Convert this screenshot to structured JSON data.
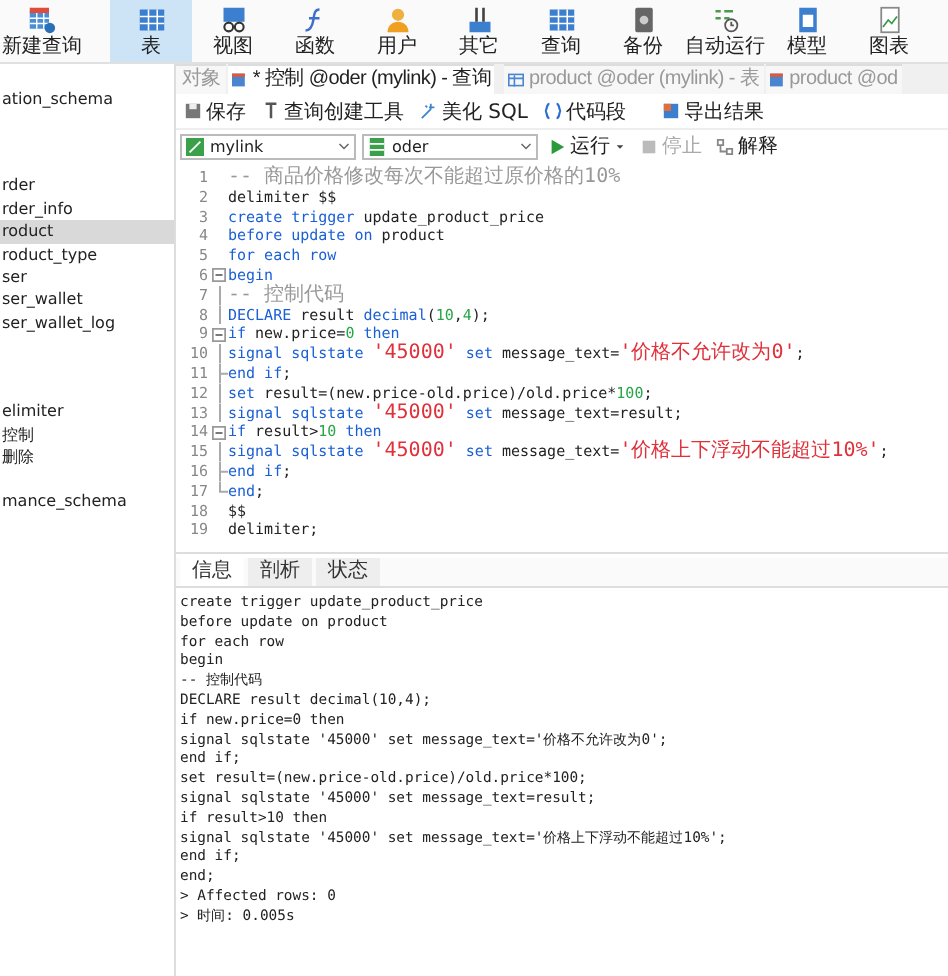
{
  "toolbar": [
    {
      "label": "新建查询",
      "selected": false
    },
    {
      "label": "表",
      "selected": true
    },
    {
      "label": "视图",
      "selected": false
    },
    {
      "label": "函数",
      "selected": false
    },
    {
      "label": "用户",
      "selected": false
    },
    {
      "label": "其它",
      "selected": false
    },
    {
      "label": "查询",
      "selected": false
    },
    {
      "label": "备份",
      "selected": false
    },
    {
      "label": "自动运行",
      "selected": false
    },
    {
      "label": "模型",
      "selected": false
    },
    {
      "label": "图表",
      "selected": false
    }
  ],
  "sidebar": {
    "groups": [
      [
        {
          "label": "ation_schema",
          "selected": false
        }
      ],
      [
        {
          "label": "rder",
          "selected": false
        },
        {
          "label": "rder_info",
          "selected": false
        },
        {
          "label": "roduct",
          "selected": true
        },
        {
          "label": "roduct_type",
          "selected": false
        },
        {
          "label": "ser",
          "selected": false
        },
        {
          "label": "ser_wallet",
          "selected": false
        },
        {
          "label": "ser_wallet_log",
          "selected": false
        }
      ],
      [
        {
          "label": "elimiter",
          "selected": false
        },
        {
          "label": "控制",
          "selected": false
        },
        {
          "label": "删除",
          "selected": false
        }
      ],
      [
        {
          "label": "mance_schema",
          "selected": false
        }
      ]
    ]
  },
  "tabs": [
    {
      "label": "对象",
      "selected": false,
      "kind": "plain"
    },
    {
      "label": "* 控制 @oder (mylink) - 查询",
      "selected": true,
      "kind": "query"
    },
    {
      "label": "product @oder (mylink) - 表",
      "selected": false,
      "kind": "table"
    },
    {
      "label": "product @od",
      "selected": false,
      "kind": "query"
    }
  ],
  "actions": [
    {
      "label": "保存",
      "kind": "save"
    },
    {
      "label": "查询创建工具",
      "kind": "builder"
    },
    {
      "label": "美化 SQL",
      "kind": "beautify"
    },
    {
      "label": "代码段",
      "kind": "snippet"
    },
    {
      "label": "导出结果",
      "kind": "export"
    }
  ],
  "connection": "mylink",
  "database": "oder",
  "run": [
    {
      "label": "运行",
      "kind": "run",
      "disabled": false
    },
    {
      "label": "停止",
      "kind": "stop",
      "disabled": true
    },
    {
      "label": "解释",
      "kind": "explain",
      "disabled": false
    }
  ],
  "editor": {
    "lines": [
      {
        "no": "1",
        "kind": "plain",
        "segments": [
          {
            "kind": "comment",
            "text": "-- 商品价格修改每次不能超过原价格的10%"
          }
        ]
      },
      {
        "no": "2",
        "kind": "plain",
        "segments": [
          {
            "kind": "plain",
            "text": "delimiter $$"
          }
        ]
      },
      {
        "no": "3",
        "kind": "plain",
        "segments": [
          {
            "kind": "keyword",
            "text": "create trigger"
          },
          {
            "kind": "plain",
            "text": " update_product_price"
          }
        ]
      },
      {
        "no": "4",
        "kind": "plain",
        "segments": [
          {
            "kind": "keyword",
            "text": "before update on"
          },
          {
            "kind": "plain",
            "text": " product"
          }
        ]
      },
      {
        "no": "5",
        "kind": "plain",
        "segments": [
          {
            "kind": "keyword",
            "text": "for each row"
          }
        ]
      },
      {
        "no": "6",
        "kind": "foldstart",
        "segments": [
          {
            "kind": "keyword",
            "text": "begin"
          }
        ]
      },
      {
        "no": "7",
        "kind": "foldbody",
        "segments": [
          {
            "kind": "comment",
            "text": "-- 控制代码"
          }
        ]
      },
      {
        "no": "8",
        "kind": "foldbody",
        "segments": [
          {
            "kind": "keyword",
            "text": "DECLARE"
          },
          {
            "kind": "plain",
            "text": " result "
          },
          {
            "kind": "keyword",
            "text": "decimal"
          },
          {
            "kind": "plain",
            "text": "("
          },
          {
            "kind": "number",
            "text": "10"
          },
          {
            "kind": "plain",
            "text": ","
          },
          {
            "kind": "number",
            "text": "4"
          },
          {
            "kind": "plain",
            "text": ");"
          }
        ]
      },
      {
        "no": "9",
        "kind": "foldstart",
        "segments": [
          {
            "kind": "keyword",
            "text": "if"
          },
          {
            "kind": "plain",
            "text": " new.price="
          },
          {
            "kind": "number",
            "text": "0"
          },
          {
            "kind": "keyword",
            "text": " then"
          }
        ]
      },
      {
        "no": "10",
        "kind": "foldbody",
        "segments": [
          {
            "kind": "keyword",
            "text": "signal sqlstate "
          },
          {
            "kind": "string",
            "text": "'45000'"
          },
          {
            "kind": "keyword",
            "text": " set"
          },
          {
            "kind": "plain",
            "text": " message_text="
          },
          {
            "kind": "string",
            "text": "'价格不允许改为0'"
          },
          {
            "kind": "plain",
            "text": ";"
          }
        ]
      },
      {
        "no": "11",
        "kind": "foldclose",
        "segments": [
          {
            "kind": "keyword",
            "text": "end if"
          },
          {
            "kind": "plain",
            "text": ";"
          }
        ]
      },
      {
        "no": "12",
        "kind": "foldbody",
        "segments": [
          {
            "kind": "keyword",
            "text": "set"
          },
          {
            "kind": "plain",
            "text": " result=(new.price-old.price)/old.price*"
          },
          {
            "kind": "number",
            "text": "100"
          },
          {
            "kind": "plain",
            "text": ";"
          }
        ]
      },
      {
        "no": "13",
        "kind": "foldbody",
        "segments": [
          {
            "kind": "keyword",
            "text": "signal sqlstate "
          },
          {
            "kind": "string",
            "text": "'45000'"
          },
          {
            "kind": "keyword",
            "text": " set"
          },
          {
            "kind": "plain",
            "text": " message_text=result;"
          }
        ]
      },
      {
        "no": "14",
        "kind": "foldstart",
        "segments": [
          {
            "kind": "keyword",
            "text": "if"
          },
          {
            "kind": "plain",
            "text": " result>"
          },
          {
            "kind": "number",
            "text": "10"
          },
          {
            "kind": "keyword",
            "text": " then"
          }
        ]
      },
      {
        "no": "15",
        "kind": "foldbody",
        "segments": [
          {
            "kind": "keyword",
            "text": "signal sqlstate "
          },
          {
            "kind": "string",
            "text": "'45000'"
          },
          {
            "kind": "keyword",
            "text": " set"
          },
          {
            "kind": "plain",
            "text": " message_text="
          },
          {
            "kind": "string",
            "text": "'价格上下浮动不能超过10%'"
          },
          {
            "kind": "plain",
            "text": ";"
          }
        ]
      },
      {
        "no": "16",
        "kind": "foldclose",
        "segments": [
          {
            "kind": "keyword",
            "text": "end if"
          },
          {
            "kind": "plain",
            "text": ";"
          }
        ]
      },
      {
        "no": "17",
        "kind": "foldend",
        "segments": [
          {
            "kind": "keyword",
            "text": "end"
          },
          {
            "kind": "plain",
            "text": ";"
          }
        ]
      },
      {
        "no": "18",
        "kind": "plain",
        "segments": [
          {
            "kind": "plain",
            "text": "$$"
          }
        ]
      },
      {
        "no": "19",
        "kind": "plain",
        "segments": [
          {
            "kind": "plain",
            "text": "delimiter;"
          }
        ]
      }
    ]
  },
  "result_tabs": [
    {
      "label": "信息",
      "selected": true
    },
    {
      "label": "剖析",
      "selected": false
    },
    {
      "label": "状态",
      "selected": false
    }
  ],
  "messages": [
    "create trigger update_product_price",
    "before update on product",
    "for each row",
    "begin",
    "-- 控制代码",
    "DECLARE result decimal(10,4);",
    "if new.price=0 then",
    "signal sqlstate '45000' set message_text='价格不允许改为0';",
    "end if;",
    "set result=(new.price-old.price)/old.price*100;",
    "signal sqlstate '45000' set message_text=result;",
    "if result>10 then",
    "signal sqlstate '45000' set message_text='价格上下浮动不能超过10%';",
    "end if;",
    "end;",
    "> Affected rows: 0",
    "> 时间: 0.005s"
  ]
}
